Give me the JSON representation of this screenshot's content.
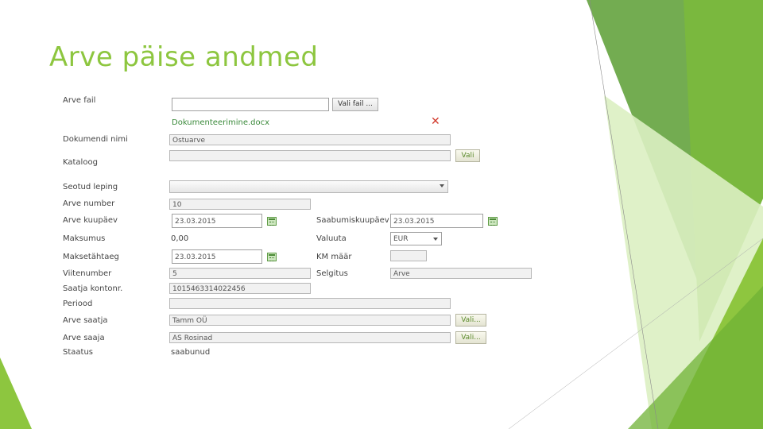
{
  "slide": {
    "title": "Arve päise andmed"
  },
  "form": {
    "arve_fail": {
      "label": "Arve fail",
      "value": "",
      "button": "Vali fail ..."
    },
    "attachment": {
      "filename": "Dokumenteerimine.docx",
      "remove": "✕"
    },
    "dokumendi_nimi": {
      "label": "Dokumendi nimi",
      "value": "Ostuarve"
    },
    "kataloog": {
      "label": "Kataloog",
      "value": "",
      "button": "Vali"
    },
    "seotud_leping": {
      "label": "Seotud leping",
      "value": ""
    },
    "arve_number": {
      "label": "Arve number",
      "value": "10"
    },
    "arve_kuupaev": {
      "label": "Arve kuupäev",
      "value": "23.03.2015"
    },
    "saabumiskuupaev": {
      "label": "Saabumiskuupäev",
      "value": "23.03.2015"
    },
    "maksumus": {
      "label": "Maksumus",
      "value": "0,00"
    },
    "valuuta": {
      "label": "Valuuta",
      "value": "EUR"
    },
    "maksetahtaeg": {
      "label": "Maksetähtaeg",
      "value": "23.03.2015"
    },
    "km_maar": {
      "label": "KM määr",
      "value": ""
    },
    "viitenumber": {
      "label": "Viitenumber",
      "value": "5"
    },
    "selgitus": {
      "label": "Selgitus",
      "value": "Arve"
    },
    "saaja_konto": {
      "label": "Saatja kontonr.",
      "value": "1015463314022456"
    },
    "periood": {
      "label": "Periood",
      "value": ""
    },
    "arve_saatja": {
      "label": "Arve saatja",
      "value": "Tamm OÜ",
      "button": "Vali..."
    },
    "arve_saaja": {
      "label": "Arve saaja",
      "value": "AS Rosinad",
      "button": "Vali..."
    },
    "staatus": {
      "label": "Staatus",
      "value": "saabunud"
    }
  },
  "colors": {
    "title": "#8dc63f",
    "accent_dark": "#4f9a2a",
    "accent_light": "#c8e29a"
  }
}
